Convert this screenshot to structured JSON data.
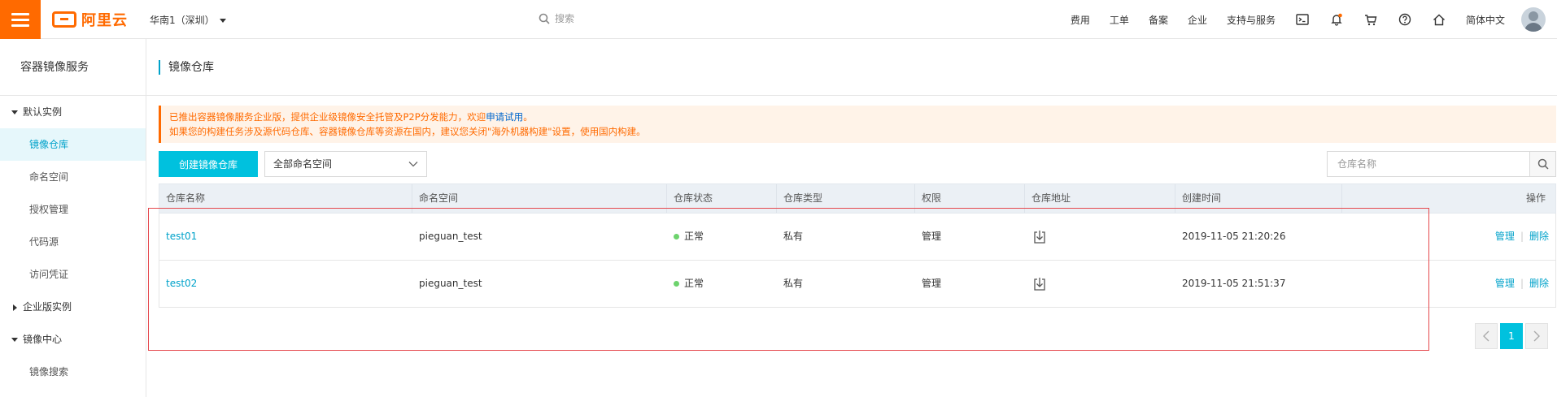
{
  "topbar": {
    "logo_text": "阿里云",
    "region": "华南1（深圳）",
    "search_placeholder": "搜索",
    "links": [
      "费用",
      "工单",
      "备案",
      "企业",
      "支持与服务"
    ],
    "language": "简体中文",
    "icons": [
      "terminal-icon",
      "bell-icon",
      "cart-icon",
      "help-icon",
      "home-icon"
    ],
    "accent_color": "#ff6a00"
  },
  "sidebar": {
    "title": "容器镜像服务",
    "groups": [
      {
        "label": "默认实例",
        "expanded": true,
        "items": [
          "镜像仓库",
          "命名空间",
          "授权管理",
          "代码源",
          "访问凭证"
        ]
      },
      {
        "label": "企业版实例",
        "expanded": false,
        "items": []
      },
      {
        "label": "镜像中心",
        "expanded": true,
        "items": [
          "镜像搜索"
        ]
      }
    ],
    "active_item": "镜像仓库"
  },
  "page": {
    "title": "镜像仓库",
    "notice_line1_prefix": "已推出容器镜像服务企业版，提供企业级镜像安全托管及P2P分发能力，欢迎",
    "notice_link": "申请试用",
    "notice_line1_suffix": "。",
    "notice_line2": "如果您的构建任务涉及源代码仓库、容器镜像仓库等资源在国内，建议您关闭\"海外机器构建\"设置，使用国内构建。",
    "create_button": "创建镜像仓库",
    "namespace_select": "全部命名空间",
    "search_placeholder": "仓库名称"
  },
  "table": {
    "columns": [
      "仓库名称",
      "命名空间",
      "仓库状态",
      "仓库类型",
      "权限",
      "仓库地址",
      "创建时间",
      "操作"
    ],
    "rows": [
      {
        "name": "test01",
        "namespace": "pieguan_test",
        "status": "正常",
        "type": "私有",
        "permission": "管理",
        "created": "2019-11-05 21:20:26",
        "action_manage": "管理",
        "action_delete": "删除"
      },
      {
        "name": "test02",
        "namespace": "pieguan_test",
        "status": "正常",
        "type": "私有",
        "permission": "管理",
        "created": "2019-11-05 21:51:37",
        "action_manage": "管理",
        "action_delete": "删除"
      }
    ],
    "action_separator": "|"
  },
  "pagination": {
    "current_page": "1"
  }
}
